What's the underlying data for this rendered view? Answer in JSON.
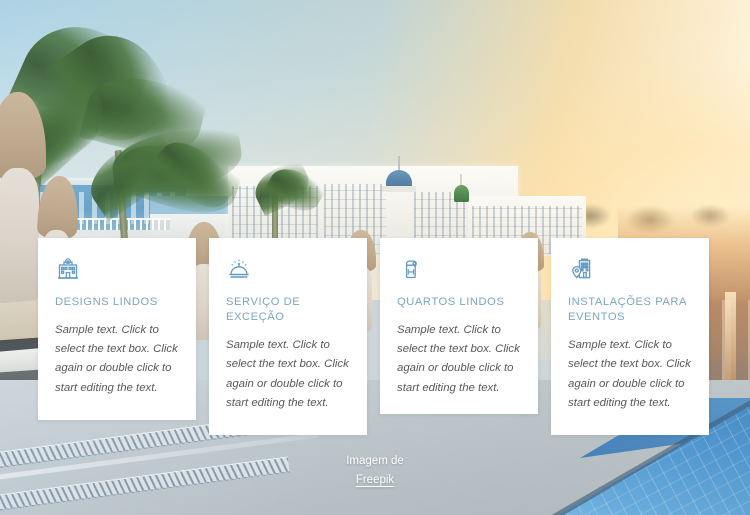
{
  "page": {
    "background_description": "Seaside resort hotel at sunset with palm trees, closed beige umbrellas, white hotel with blue and green domes, and a blue swimming pool",
    "accent_color": "#7ba6c4",
    "card_background": "#ffffff",
    "body_text_color": "#58595b"
  },
  "cards": [
    {
      "icon": "hotel-building-icon",
      "title": "DESIGNS LINDOS",
      "text": "Sample text. Click to select the text box. Click again or double click to start editing the text."
    },
    {
      "icon": "service-bell-icon",
      "title": "SERVIÇO DE EXCEÇÃO",
      "text": "Sample text. Click to select the text box. Click again or double click to start editing the text."
    },
    {
      "icon": "door-hanger-icon",
      "title": "QUARTOS LINDOS",
      "text": "Sample text. Click to select the text box. Click again or double click to start editing the text."
    },
    {
      "icon": "location-pin-hotel-icon",
      "title": "INSTALAÇÕES PARA EVENTOS",
      "text": "Sample text. Click to select the text box. Click again or double click to start editing the text."
    }
  ],
  "credit": {
    "prefix": "Imagem de",
    "link_label": "Freepik"
  }
}
